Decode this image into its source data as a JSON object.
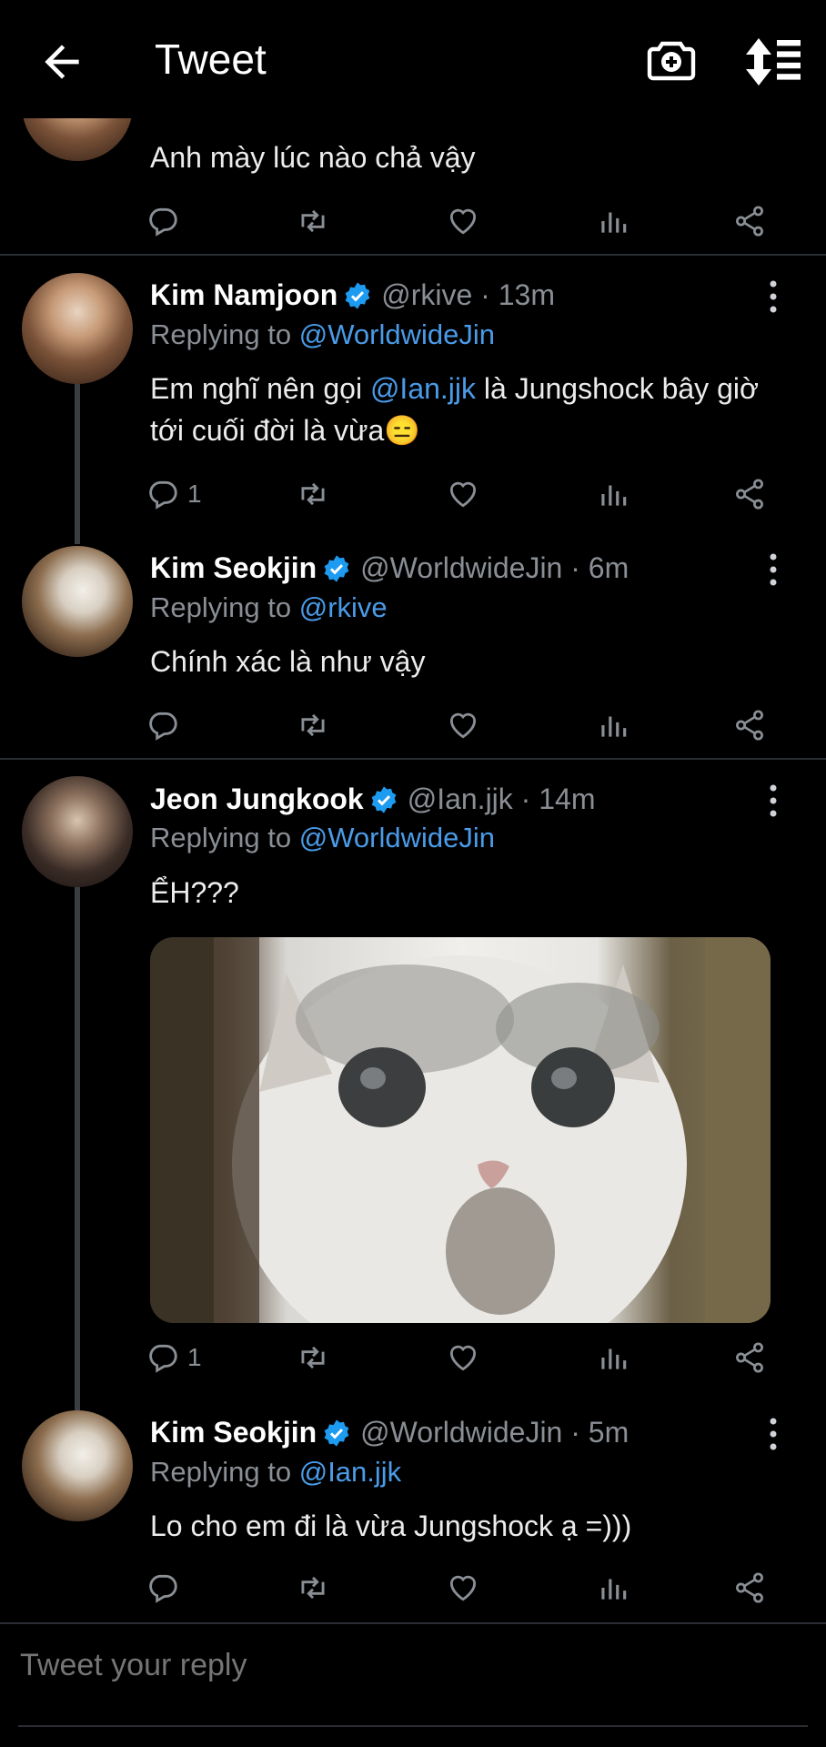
{
  "header": {
    "title": "Tweet"
  },
  "tweets": [
    {
      "text": "Anh mày lúc nào chả vậy",
      "reply_count": ""
    },
    {
      "name": "Kim Namjoon",
      "handle": "@rkive · 13m",
      "replying_prefix": "Replying to ",
      "replying_to": "@WorldwideJin",
      "text_parts": [
        "Em nghĩ nên gọi ",
        "@Ian.jjk",
        " là Jungshock bây giờ",
        "tới cuối đời là vừa😑"
      ],
      "reply_count": "1"
    },
    {
      "name": "Kim Seokjin",
      "handle": "@WorldwideJin · 6m",
      "replying_prefix": "Replying to ",
      "replying_to": "@rkive",
      "text": "Chính  xác là như vậy",
      "reply_count": ""
    },
    {
      "name": "Jeon Jungkook",
      "handle": "@Ian.jjk · 14m",
      "replying_prefix": "Replying to ",
      "replying_to": "@WorldwideJin",
      "text": "ỂH???",
      "reply_count": "1"
    },
    {
      "name": "Kim Seokjin",
      "handle": "@WorldwideJin · 5m",
      "replying_prefix": "Replying to ",
      "replying_to": "@Ian.jjk",
      "text": "Lo cho em đi là vừa Jungshock ạ =)))",
      "reply_count": ""
    }
  ],
  "reply": {
    "placeholder": "Tweet your reply"
  },
  "colors": {
    "background": "#000000",
    "mention": "#4a9be8",
    "muted": "#8a8f95",
    "verified": "#1d9bf0"
  }
}
